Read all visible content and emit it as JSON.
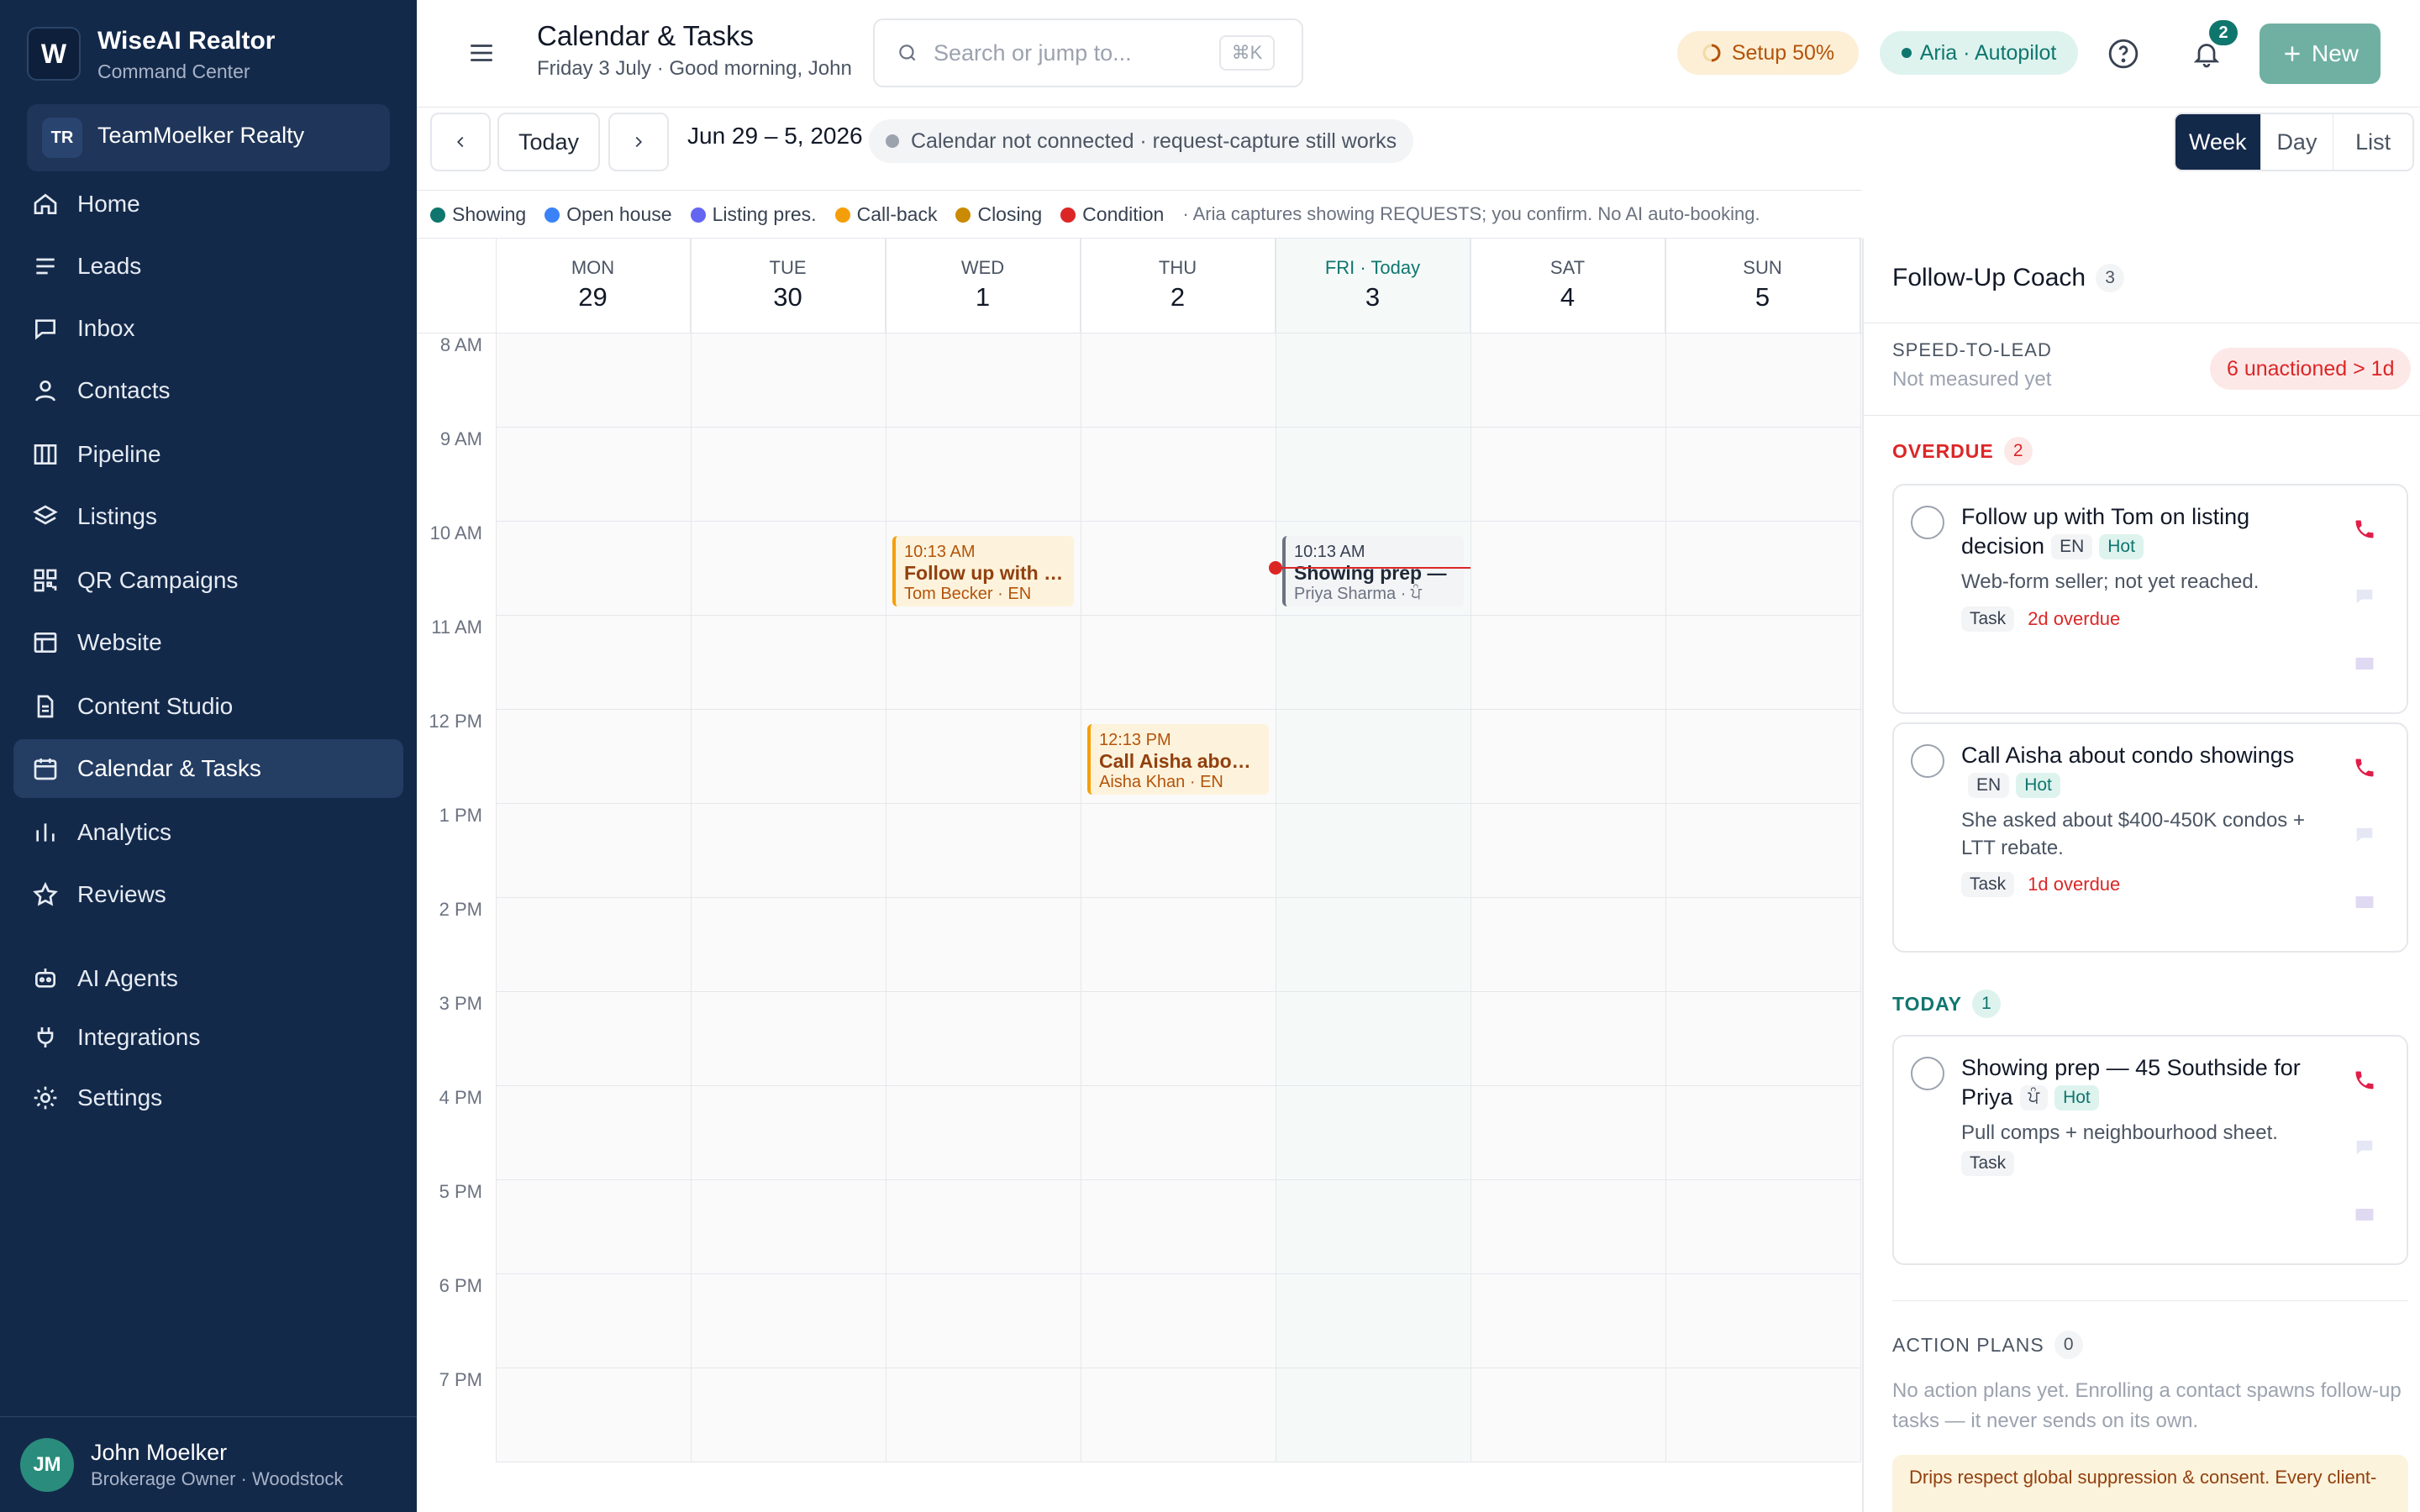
{
  "sidebar": {
    "logo_letter": "W",
    "brand": "WiseAI Realtor",
    "brand_sub": "Command Center",
    "team_initials": "TR",
    "team_name": "TeamMoelker Realty",
    "items": [
      {
        "label": "Home",
        "icon": "home-icon"
      },
      {
        "label": "Leads",
        "icon": "list-icon"
      },
      {
        "label": "Inbox",
        "icon": "chat-icon"
      },
      {
        "label": "Contacts",
        "icon": "user-icon"
      },
      {
        "label": "Pipeline",
        "icon": "columns-icon"
      },
      {
        "label": "Listings",
        "icon": "layers-icon"
      },
      {
        "label": "QR Campaigns",
        "icon": "qr-icon"
      },
      {
        "label": "Website",
        "icon": "layout-icon"
      },
      {
        "label": "Content Studio",
        "icon": "file-icon"
      },
      {
        "label": "Calendar & Tasks",
        "icon": "calendar-icon"
      },
      {
        "label": "Analytics",
        "icon": "bar-chart-icon"
      },
      {
        "label": "Reviews",
        "icon": "star-icon"
      },
      {
        "label": "AI Agents",
        "icon": "bot-icon"
      },
      {
        "label": "Integrations",
        "icon": "plug-icon"
      },
      {
        "label": "Settings",
        "icon": "gear-icon"
      }
    ],
    "active_index": 9,
    "user_initials": "JM",
    "user_name": "John Moelker",
    "user_role": "Brokerage Owner · Woodstock"
  },
  "header": {
    "title": "Calendar & Tasks",
    "subtitle": "Friday 3 July · Good morning, John",
    "search_placeholder": "Search or jump to...",
    "search_shortcut": "⌘K",
    "setup": "Setup 50%",
    "aria": "Aria · Autopilot",
    "notif_count": "2",
    "new_label": "New"
  },
  "toolbar": {
    "today": "Today",
    "range": "Jun 29 – 5, 2026",
    "cal_note": "Calendar not connected · request-capture still works",
    "views": [
      "Week",
      "Day",
      "List"
    ],
    "active_view": "Week"
  },
  "legend": {
    "items": [
      {
        "label": "Showing",
        "color": "#0f766e"
      },
      {
        "label": "Open house",
        "color": "#3b82f6"
      },
      {
        "label": "Listing pres.",
        "color": "#6366f1"
      },
      {
        "label": "Call-back",
        "color": "#f59e0b"
      },
      {
        "label": "Closing",
        "color": "#ca8a04"
      },
      {
        "label": "Condition",
        "color": "#dc2626"
      }
    ],
    "note": "· Aria captures showing REQUESTS; you confirm. No AI auto-booking."
  },
  "calendar": {
    "days": [
      {
        "name": "MON",
        "num": "29"
      },
      {
        "name": "TUE",
        "num": "30"
      },
      {
        "name": "WED",
        "num": "1"
      },
      {
        "name": "THU",
        "num": "2"
      },
      {
        "name": "FRI · Today",
        "num": "3"
      },
      {
        "name": "SAT",
        "num": "4"
      },
      {
        "name": "SUN",
        "num": "5"
      }
    ],
    "today_index": 4,
    "hours": [
      "8 AM",
      "9 AM",
      "10 AM",
      "11 AM",
      "12 PM",
      "1 PM",
      "2 PM",
      "3 PM",
      "4 PM",
      "5 PM",
      "6 PM",
      "7 PM"
    ],
    "events": [
      {
        "day": 2,
        "time": "10:13 AM",
        "title": "Follow up with T...",
        "meta": "Tom Becker · EN",
        "kind": "call"
      },
      {
        "day": 3,
        "time": "12:13 PM",
        "title": "Call Aisha about ...",
        "meta": "Aisha Khan · EN",
        "kind": "call"
      },
      {
        "day": 4,
        "time": "10:13 AM",
        "title": "Showing prep —",
        "meta": "Priya Sharma · ਪੰ",
        "kind": "task"
      }
    ]
  },
  "coach": {
    "title": "Follow-Up Coach",
    "count": "3",
    "speed_label": "SPEED-TO-LEAD",
    "speed_value": "Not measured yet",
    "unactioned": "6 unactioned > 1d",
    "overdue_label": "OVERDUE",
    "overdue_count": "2",
    "today_label": "TODAY",
    "today_count": "1",
    "cards": [
      {
        "title": "Follow up with Tom on listing decision",
        "lang": "EN",
        "heat": "Hot",
        "desc": "Web-form seller; not yet reached.",
        "type": "Task",
        "status": "2d overdue"
      },
      {
        "title": "Call Aisha about condo showings",
        "lang": "EN",
        "heat": "Hot",
        "desc": "She asked about $400-450K condos + LTT rebate.",
        "type": "Task",
        "status": "1d overdue"
      },
      {
        "title": "Showing prep — 45 Southside for Priya",
        "lang": "ਪੰ",
        "heat": "Hot",
        "desc": "Pull comps + neighbourhood sheet.",
        "type": "Task",
        "status": ""
      }
    ],
    "plans_label": "ACTION PLANS",
    "plans_count": "0",
    "plans_text": "No action plans yet. Enrolling a contact spawns follow-up tasks — it never sends on its own.",
    "drips_text": "Drips respect global suppression & consent. Every client-"
  }
}
